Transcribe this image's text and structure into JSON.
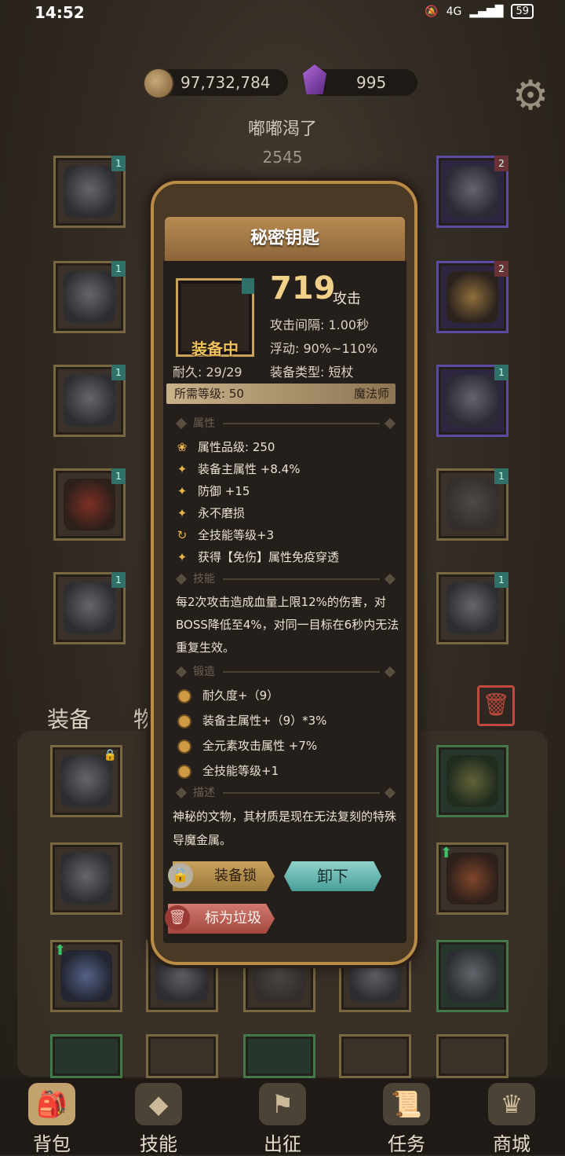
{
  "status": {
    "time": "14:52",
    "network": "4G",
    "battery": "59"
  },
  "currency": {
    "gold": "97,732,784",
    "gems": "995"
  },
  "character": {
    "name": "嘟嘟渴了",
    "score": "2545"
  },
  "left_slots": [
    {
      "tag": "1"
    },
    {
      "tag": "1"
    },
    {
      "tag": "1"
    },
    {
      "tag": "1"
    },
    {
      "tag": "1"
    }
  ],
  "right_slots": [
    {
      "tag": "2"
    },
    {
      "tag": "2"
    },
    {
      "tag": "1"
    },
    {
      "tag": "1"
    },
    {
      "tag": "1"
    }
  ],
  "tabs": {
    "equipment": "装备",
    "items": "物品"
  },
  "popup": {
    "title": "秘密钥匙",
    "equipped_label": "装备中",
    "attack_value": "719",
    "attack_unit": "攻击",
    "attack_interval": "攻击间隔: 1.00秒",
    "variance": "浮动: 90%~110%",
    "durability": "耐久: 29/29",
    "equip_type": "装备类型: 短杖",
    "required_level": "所需等级: 50",
    "class": "魔法师",
    "sections": {
      "attributes": "属性",
      "skill": "技能",
      "forge": "锻造",
      "description": "描述"
    },
    "attributes": [
      {
        "icon": "lotus-icon",
        "text": "属性品级: 250"
      },
      {
        "icon": "sparkle-icon",
        "text": "装备主属性 +8.4%"
      },
      {
        "icon": "sparkle-icon",
        "text": "防御 +15"
      },
      {
        "icon": "sparkle-icon",
        "text": "永不磨损"
      },
      {
        "icon": "cycle-icon",
        "text": "全技能等级+3"
      },
      {
        "icon": "sparkle-icon",
        "text": "获得【免伤】属性免疫穿透"
      }
    ],
    "skill_text": "每2次攻击造成血量上限12%的伤害，对BOSS降低至4%，对同一目标在6秒内无法重复生效。",
    "forge": [
      "耐久度+（9）",
      "装备主属性+（9）*3%",
      "全元素攻击属性 +7%",
      "全技能等级+1"
    ],
    "description": "神秘的文物，其材质是现在无法复刻的特殊导魔金属。",
    "buttons": {
      "lock": "装备锁",
      "unequip": "卸下",
      "junk": "标为垃圾"
    }
  },
  "bottom_nav": [
    {
      "label": "背包",
      "icon": "bag-icon"
    },
    {
      "label": "技能",
      "icon": "skill-book-icon"
    },
    {
      "label": "出征",
      "icon": "banner-icon"
    },
    {
      "label": "任务",
      "icon": "scroll-icon"
    },
    {
      "label": "商城",
      "icon": "crown-shop-icon"
    }
  ]
}
